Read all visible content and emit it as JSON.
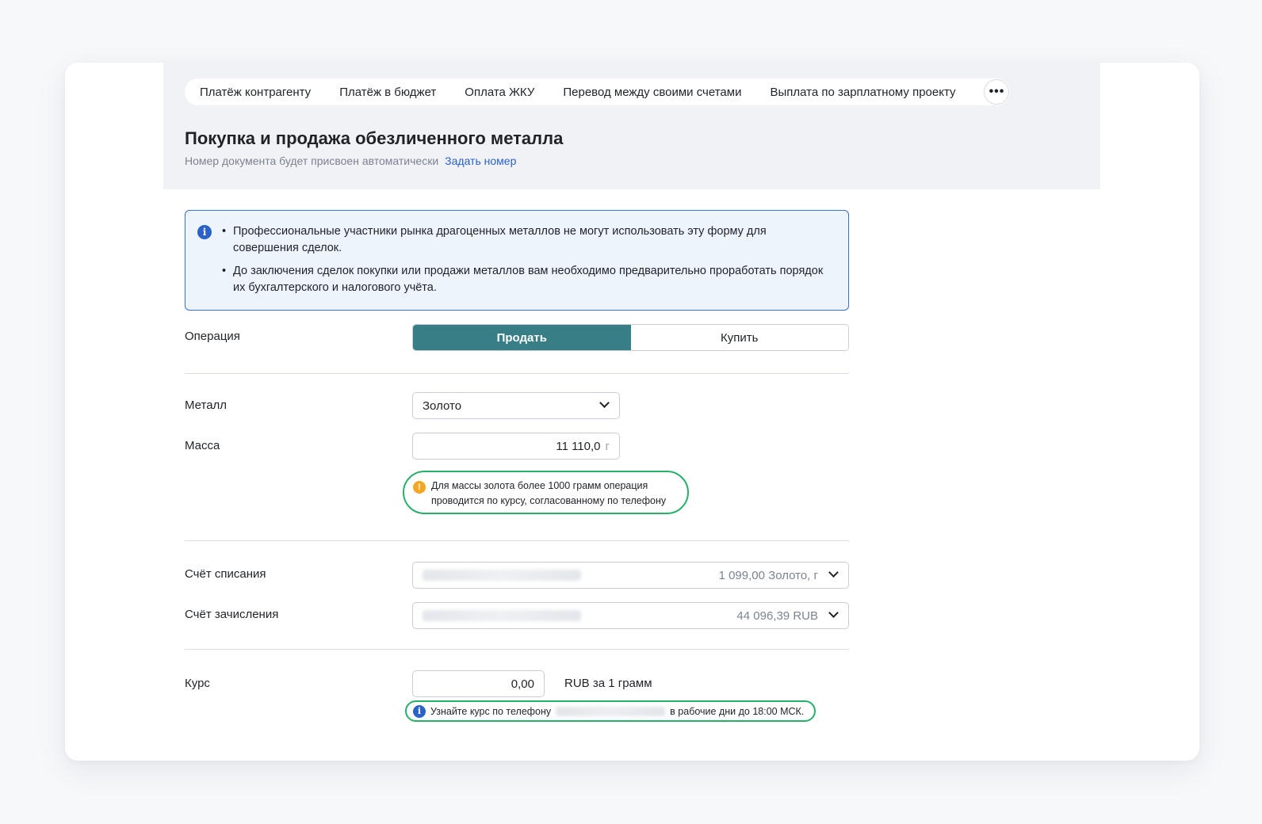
{
  "tabs": [
    {
      "label": "Платёж контрагенту"
    },
    {
      "label": "Платёж в бюджет"
    },
    {
      "label": "Оплата ЖКУ"
    },
    {
      "label": "Перевод между своими счетами"
    },
    {
      "label": "Выплата по зарплатному проекту"
    }
  ],
  "more_icon": "•••",
  "page": {
    "title": "Покупка и продажа обезличенного металла",
    "subtitle": "Номер документа будет присвоен автоматически",
    "set_number_link": "Задать номер"
  },
  "info": {
    "icon": "i",
    "items": [
      "Профессиональные участники рынка драгоценных металлов не могут использовать эту форму для совершения сделок.",
      "До заключения сделок покупки или продажи металлов вам необходимо предварительно проработать порядок их бухгалтерского и налогового учёта."
    ]
  },
  "operation": {
    "label": "Операция",
    "sell": "Продать",
    "buy": "Купить",
    "selected": "sell"
  },
  "metal": {
    "label": "Металл",
    "value": "Золото"
  },
  "mass": {
    "label": "Масса",
    "value": "11 110,0",
    "unit": "г",
    "warning_icon": "!",
    "warning": "Для массы золота более 1000 грамм операция проводится по курсу, согласованному по телефону"
  },
  "debit_account": {
    "label": "Счёт списания",
    "amount": "1 099,00 Золото, г"
  },
  "credit_account": {
    "label": "Счёт зачисления",
    "amount": "44 096,39 RUB"
  },
  "rate": {
    "label": "Курс",
    "value": "0,00",
    "unit": "RUB за 1 грамм",
    "note_icon": "i",
    "note_before": "Узнайте курс по телефону",
    "note_after": "в рабочие дни до 18:00 МСК."
  },
  "colors": {
    "accent": "#377e87",
    "link": "#2a62c9",
    "highlight": "#26b06a",
    "warning": "#f5a623"
  }
}
